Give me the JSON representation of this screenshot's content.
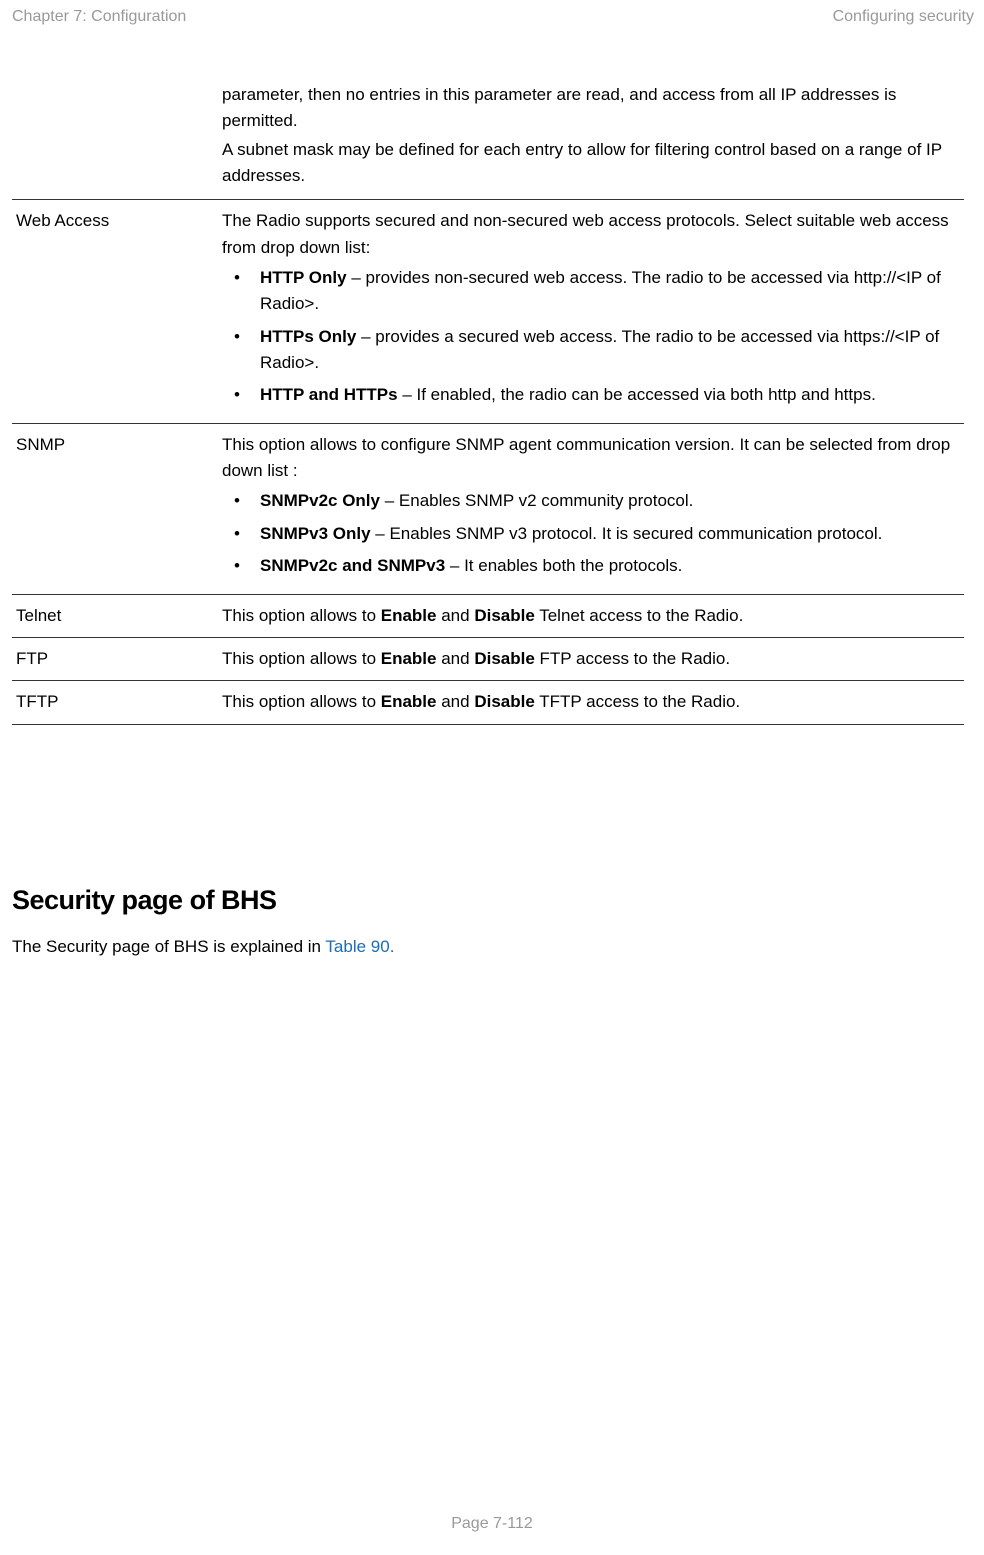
{
  "header": {
    "left": "Chapter 7:  Configuration",
    "right": "Configuring security"
  },
  "rows": {
    "intro": {
      "p1": "parameter, then no entries in this parameter are read, and access from all IP addresses is permitted.",
      "p2": "A subnet mask may be defined for each entry to allow for filtering control based on a range of IP addresses."
    },
    "webaccess": {
      "label": "Web Access",
      "intro": "The Radio supports secured and non-secured web access protocols. Select suitable web access from drop down list:",
      "b1_bold": "HTTP Only",
      "b1_rest": " – provides non-secured web access. The radio to be accessed via http://<IP of Radio>.",
      "b2_bold": "HTTPs Only",
      "b2_rest": " – provides a secured web access. The radio to be accessed via https://<IP of Radio>.",
      "b3_bold": "HTTP and HTTPs",
      "b3_rest": " – If enabled, the radio can be accessed via both http and https."
    },
    "snmp": {
      "label": "SNMP",
      "intro": "This option allows to configure SNMP agent communication version. It can be selected from drop down list :",
      "b1_bold": "SNMPv2c Only",
      "b1_rest": " – Enables SNMP v2 community protocol.",
      "b2_bold": "SNMPv3 Only",
      "b2_rest": " – Enables SNMP v3 protocol. It is secured communication protocol.",
      "b3_bold": "SNMPv2c and SNMPv3",
      "b3_rest": " – It enables both the protocols."
    },
    "telnet": {
      "label": "Telnet",
      "t1": "This option allows to ",
      "b1": "Enable",
      "t2": " and ",
      "b2": "Disable",
      "t3": " Telnet access to the Radio."
    },
    "ftp": {
      "label": "FTP",
      "t1": "This option allows to ",
      "b1": "Enable",
      "t2": " and ",
      "b2": "Disable",
      "t3": " FTP access to the Radio."
    },
    "tftp": {
      "label": "TFTP",
      "t1": "This option allows to ",
      "b1": "Enable",
      "t2": " and ",
      "b2": "Disable",
      "t3": " TFTP access to the Radio."
    }
  },
  "section": {
    "heading": "Security page of BHS",
    "text_pre": "The Security page of BHS is explained in ",
    "link": "Table 90.",
    "text_post": ""
  },
  "footer": "Page 7-112"
}
